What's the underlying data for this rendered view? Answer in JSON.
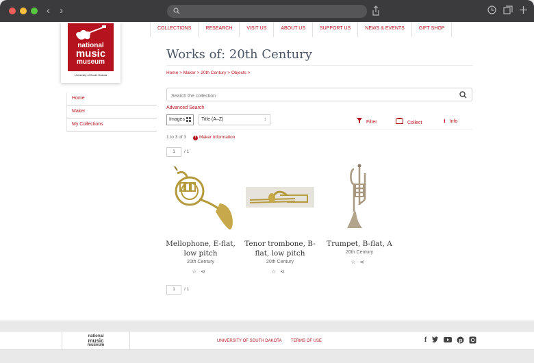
{
  "browser": {
    "nav_arrows": "‹ ›"
  },
  "logo": {
    "line1": "national",
    "line2": "music",
    "line3": "museum",
    "sub": "University of South Dakota"
  },
  "topnav": [
    "COLLECTIONS",
    "RESEARCH",
    "VISIT US",
    "ABOUT US",
    "SUPPORT US",
    "NEWS & EVENTS",
    "GIFT SHOP"
  ],
  "page": {
    "title": "Works of: 20th Century",
    "breadcrumb": "Home > Maker > 20th Century > Objects >"
  },
  "sidenav": [
    "Home",
    "Maker",
    "My Collections"
  ],
  "search": {
    "placeholder": "Search the collection",
    "advanced": "Advanced Search"
  },
  "controls": {
    "view": "Images",
    "sort": "Title (A–Z)",
    "filter": "Filter",
    "collect": "Collect",
    "info": "Info"
  },
  "results": {
    "count": "1 to 3 of 3",
    "maker_info": "Maker Information",
    "page": "1",
    "page_total": "/ 1"
  },
  "items": [
    {
      "title": "Mellophone, E-flat, low pitch",
      "sub": "20th Century",
      "icon": "mellophone-image"
    },
    {
      "title": "Tenor trombone, B-flat, low pitch",
      "sub": "20th Century",
      "icon": "trombone-image"
    },
    {
      "title": "Trumpet, B-flat, A",
      "sub": "20th Century",
      "icon": "trumpet-image"
    }
  ],
  "footer": {
    "logo_l1": "national",
    "logo_l2": "music",
    "logo_l3": "museum",
    "link1": "UNIVERSITY OF SOUTH DAKOTA",
    "link2": "TERMS OF USE",
    "social": [
      "facebook-icon",
      "twitter-icon",
      "youtube-icon",
      "pinterest-icon",
      "instagram-icon"
    ]
  },
  "colors": {
    "accent": "#b5141e",
    "title": "#4c5667"
  }
}
